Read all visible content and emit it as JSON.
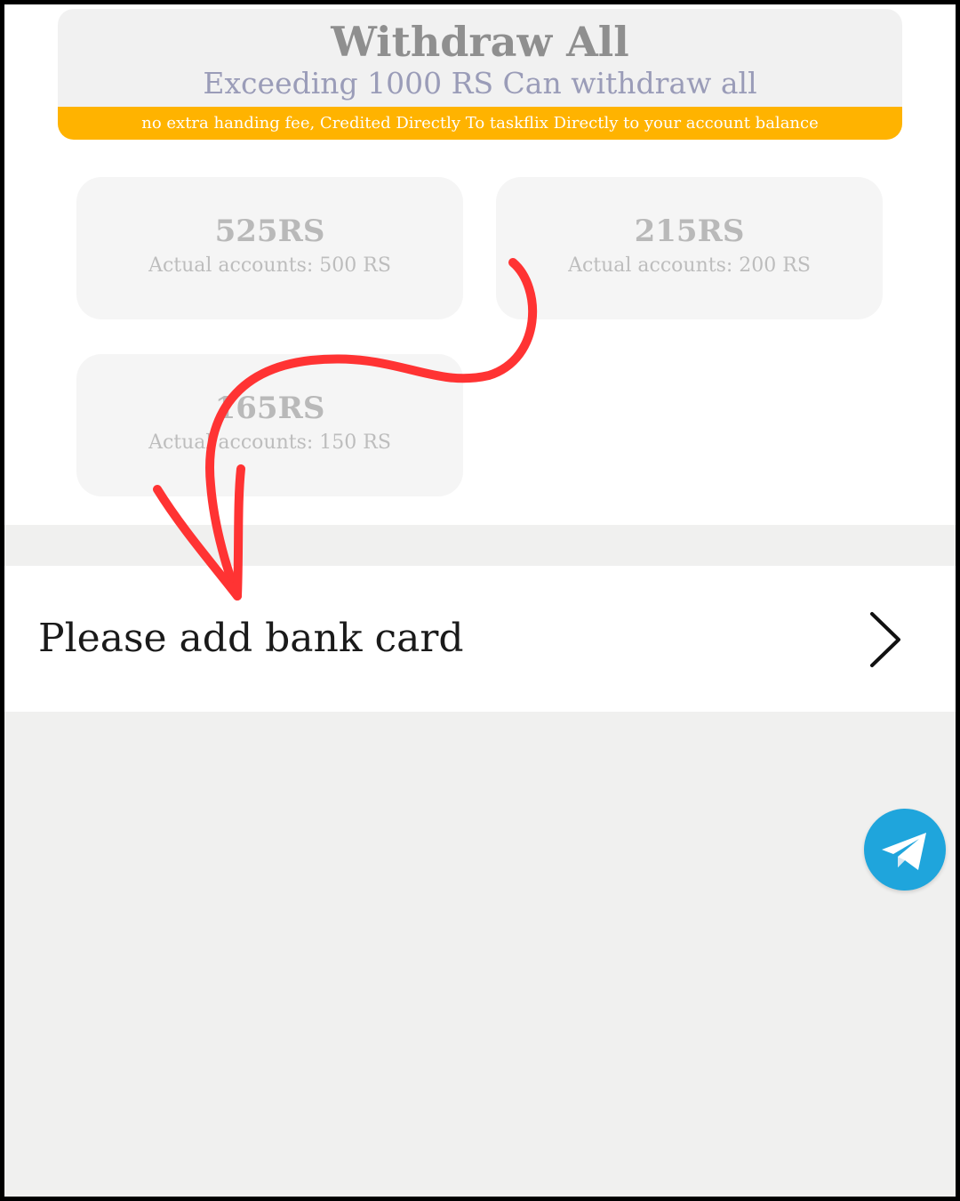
{
  "withdraw_all": {
    "title": "Withdraw All",
    "subtitle": "Exceeding 1000 RS Can withdraw all",
    "banner": "no extra handing fee, Credited Directly To taskflix Directly to your account balance"
  },
  "amount_options": [
    {
      "value": "525RS",
      "actual": "Actual accounts: 500 RS"
    },
    {
      "value": "215RS",
      "actual": "Actual accounts: 200 RS"
    },
    {
      "value": "165RS",
      "actual": "Actual accounts: 150 RS"
    }
  ],
  "bank_card": {
    "label": "Please add bank card"
  },
  "icons": {
    "chevron": "chevron-right-icon",
    "telegram": "telegram-icon",
    "annotation": "red-arrow"
  },
  "colors": {
    "banner": "#ffb300",
    "telegram": "#1fa5dc",
    "annotation_arrow": "#ff3333",
    "page_gray": "#f0f0ef"
  }
}
